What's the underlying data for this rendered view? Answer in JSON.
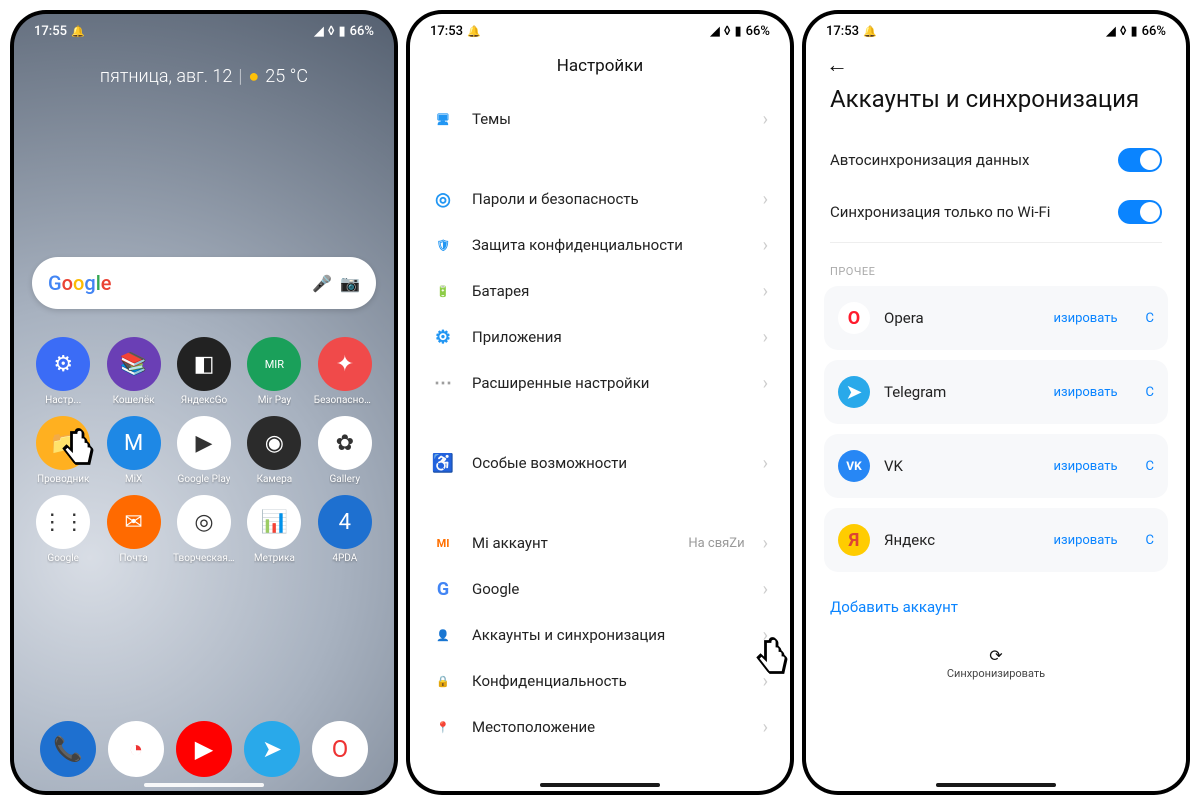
{
  "status": {
    "time_home": "17:55",
    "time_settings": "17:53",
    "time_accounts": "17:53",
    "battery": "66%",
    "alarm_glyph": "⏰",
    "signal_glyph": "▲",
    "wifi_glyph": "▾",
    "battery_glyph": "▮"
  },
  "home": {
    "weather_date": "пятница, авг. 12",
    "weather_temp": "25 °C",
    "search_brand": "Google",
    "apps_row1": [
      {
        "label": "Настр...",
        "bg": "#3b6cf6",
        "glyph": "⚙"
      },
      {
        "label": "Кошелёк",
        "bg": "#6a3fb5",
        "glyph": "📚"
      },
      {
        "label": "ЯндексGo",
        "bg": "#222",
        "glyph": "◧"
      },
      {
        "label": "Mir Pay",
        "bg": "#1aa05a",
        "glyph": "MIR"
      },
      {
        "label": "Безопасност..",
        "bg": "#f04a4a",
        "glyph": "✦"
      }
    ],
    "apps_row2": [
      {
        "label": "Проводник",
        "bg": "#ffb020",
        "glyph": "📁"
      },
      {
        "label": "MiX",
        "bg": "#1e88e5",
        "glyph": "M"
      },
      {
        "label": "Google Play",
        "bg": "#fff",
        "glyph": "▶"
      },
      {
        "label": "Камера",
        "bg": "#2b2b2b",
        "glyph": "◉"
      },
      {
        "label": "Gallery",
        "bg": "#fff",
        "glyph": "✿"
      }
    ],
    "apps_row3": [
      {
        "label": "Google",
        "bg": "#fff",
        "glyph": "⋮⋮"
      },
      {
        "label": "Почта",
        "bg": "#ff6a00",
        "glyph": "✉"
      },
      {
        "label": "Творческая ..",
        "bg": "#fff",
        "glyph": "◎"
      },
      {
        "label": "Метрика",
        "bg": "#fff",
        "glyph": "📊"
      },
      {
        "label": "4PDA",
        "bg": "#1e70d0",
        "glyph": "4"
      }
    ],
    "dock": [
      {
        "bg": "#1e70d0",
        "glyph": "📞"
      },
      {
        "bg": "#fff",
        "glyph": "◔"
      },
      {
        "bg": "#ff0000",
        "glyph": "▶"
      },
      {
        "bg": "#29a9ea",
        "glyph": "➤"
      },
      {
        "bg": "#fff",
        "glyph": "O"
      }
    ]
  },
  "settings": {
    "title": "Настройки",
    "rows": [
      {
        "icon": "🖥",
        "color": "#2196f3",
        "label": "Темы"
      },
      {
        "gap": true
      },
      {
        "icon": "◎",
        "color": "#2196f3",
        "label": "Пароли и безопасность"
      },
      {
        "icon": "🛡",
        "color": "#2196f3",
        "label": "Защита конфиденциальности"
      },
      {
        "icon": "🔋",
        "color": "#4caf50",
        "label": "Батарея"
      },
      {
        "icon": "⚙",
        "color": "#2196f3",
        "label": "Приложения"
      },
      {
        "icon": "⋯",
        "color": "#9e9e9e",
        "label": "Расширенные настройки"
      },
      {
        "gap": true
      },
      {
        "icon": "♿",
        "color": "#7c4dff",
        "label": "Особые возможности"
      },
      {
        "gap": true
      },
      {
        "icon": "MI",
        "color": "#ff6f00",
        "label": "Mi аккаунт",
        "value": "На свяZи"
      },
      {
        "icon": "G",
        "color": "#4285f4",
        "label": "Google"
      },
      {
        "icon": "👤",
        "color": "#616161",
        "label": "Аккаунты и синхронизация"
      },
      {
        "icon": "🔒",
        "color": "#616161",
        "label": "Конфиденциальность"
      },
      {
        "icon": "📍",
        "color": "#616161",
        "label": "Местоположение"
      }
    ]
  },
  "accounts": {
    "title": "Аккаунты и синхронизация",
    "toggle1": "Автосинхронизация данных",
    "toggle2": "Синхронизация только по Wi-Fi",
    "section": "ПРОЧЕЕ",
    "items": [
      {
        "name": "Opera",
        "bg": "#fff",
        "fg": "#ff1b2d",
        "glyph": "O",
        "action": "изировать",
        "extra": "С"
      },
      {
        "name": "Telegram",
        "bg": "#29a9ea",
        "fg": "#fff",
        "glyph": "➤",
        "action": "изировать",
        "extra": "С"
      },
      {
        "name": "VK",
        "bg": "#2787f5",
        "fg": "#fff",
        "glyph": "VK",
        "action": "изировать",
        "extra": "С"
      },
      {
        "name": "Яндекс",
        "bg": "#ffcc00",
        "fg": "#d43",
        "glyph": "Я",
        "action": "изировать",
        "extra": "С"
      }
    ],
    "add": "Добавить аккаунт",
    "sync_all": "Синхронизировать"
  }
}
